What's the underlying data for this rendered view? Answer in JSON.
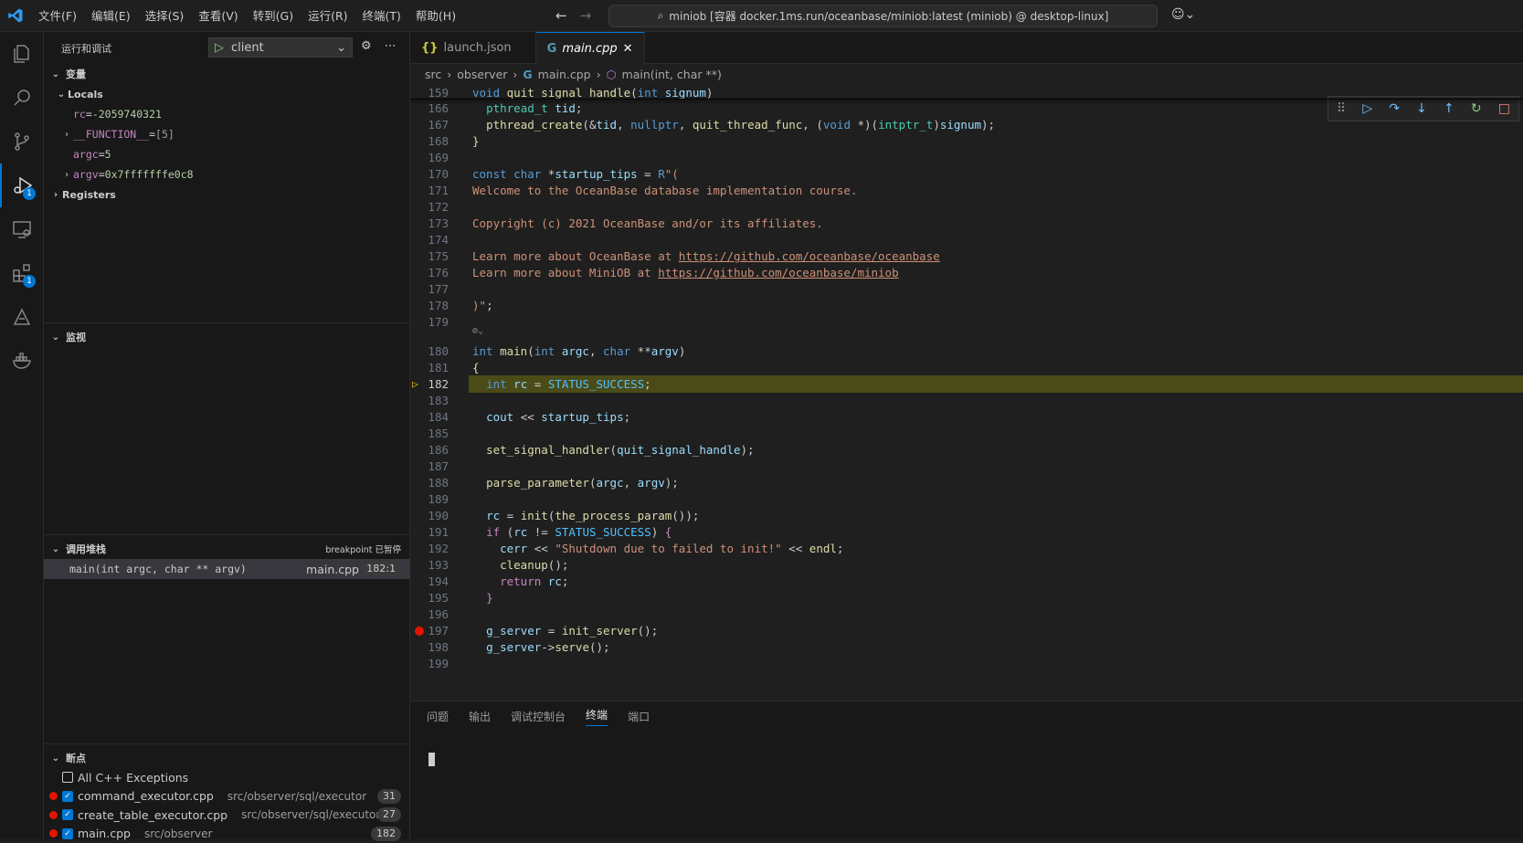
{
  "window": {
    "menus": [
      "文件(F)",
      "编辑(E)",
      "选择(S)",
      "查看(V)",
      "转到(G)",
      "运行(R)",
      "终端(T)",
      "帮助(H)"
    ],
    "command_center": "miniob [容器 docker.1ms.run/oceanbase/miniob:latest (miniob) @ desktop-linux]"
  },
  "activity": {
    "debug_badge": "1",
    "extensions_badge": "1"
  },
  "sidebar": {
    "title": "运行和调试",
    "launch_config": "client",
    "variables": {
      "header": "变量",
      "locals_label": "Locals",
      "items": [
        {
          "name": "rc",
          "value": "-2059740321",
          "expandable": false
        },
        {
          "name": "__FUNCTION__",
          "value": "[5]",
          "expandable": true
        },
        {
          "name": "argc",
          "value": "5",
          "expandable": false
        },
        {
          "name": "argv",
          "value": "0x7fffffffe0c8",
          "expandable": true
        }
      ],
      "registers_label": "Registers"
    },
    "watch": {
      "header": "监视"
    },
    "callstack": {
      "header": "调用堆栈",
      "status": "breakpoint 已暂停",
      "frame_fn": "main(int argc, char ** argv)",
      "frame_file": "main.cpp",
      "frame_pos": "182:1"
    },
    "breakpoints": {
      "header": "断点",
      "items": [
        {
          "label": "All C++ Exceptions",
          "path": "",
          "count": "",
          "checked": false,
          "dot": false
        },
        {
          "label": "command_executor.cpp",
          "path": "src/observer/sql/executor",
          "count": "31",
          "checked": true,
          "dot": true
        },
        {
          "label": "create_table_executor.cpp",
          "path": "src/observer/sql/executor",
          "count": "27",
          "checked": true,
          "dot": true
        },
        {
          "label": "main.cpp",
          "path": "src/observer",
          "count": "182",
          "checked": true,
          "dot": true
        }
      ]
    }
  },
  "editor": {
    "tabs": [
      {
        "label": "launch.json",
        "icon": "{}",
        "active": false
      },
      {
        "label": "main.cpp",
        "icon": "G",
        "active": true
      }
    ],
    "breadcrumb": [
      "src",
      "observer",
      "main.cpp",
      "main(int, char **)"
    ],
    "lines": [
      {
        "n": "159",
        "html": "<span class='kw'>void</span> <span class='fn'>quit_signal_handle</span>(<span class='kw'>int</span> <span class='va'>signum</span>)"
      },
      {
        "n": "166",
        "html": "  <span class='ty'>pthread_t</span> <span class='va'>tid</span>;"
      },
      {
        "n": "167",
        "html": "  <span class='fn'>pthread_create</span>(&amp;<span class='va'>tid</span>, <span class='kw'>nullptr</span>, <span class='fn'>quit_thread_func</span>, (<span class='kw'>void</span> *)(<span class='ty'>intptr_t</span>)<span class='va'>signum</span>);"
      },
      {
        "n": "168",
        "html": "<span class='fn'>}</span>"
      },
      {
        "n": "169",
        "html": ""
      },
      {
        "n": "170",
        "html": "<span class='kw'>const</span> <span class='kw'>char</span> *<span class='va'>startup_tips</span> = <span class='kw'>R</span><span class='st'>\"(</span>"
      },
      {
        "n": "171",
        "html": "<span class='st'>Welcome to the OceanBase database implementation course.</span>"
      },
      {
        "n": "172",
        "html": ""
      },
      {
        "n": "173",
        "html": "<span class='st'>Copyright (c) 2021 OceanBase and/or its affiliates.</span>"
      },
      {
        "n": "174",
        "html": ""
      },
      {
        "n": "175",
        "html": "<span class='st'>Learn more about OceanBase at </span><span class='url'>https://github.com/oceanbase/oceanbase</span>"
      },
      {
        "n": "176",
        "html": "<span class='st'>Learn more about MiniOB at </span><span class='url'>https://github.com/oceanbase/miniob</span>"
      },
      {
        "n": "177",
        "html": ""
      },
      {
        "n": "178",
        "html": "<span class='st'>)\"</span>;"
      },
      {
        "n": "179",
        "html": ""
      },
      {
        "n": "180",
        "html": "<span class='kw'>int</span> <span class='fn'>main</span>(<span class='kw'>int</span> <span class='va'>argc</span>, <span class='kw'>char</span> **<span class='va'>argv</span>)"
      },
      {
        "n": "181",
        "html": "<span class='fn'>{</span>"
      },
      {
        "n": "182",
        "html": "  <span class='kw'>int</span> <span class='va'>rc</span> = <span class='co'>STATUS_SUCCESS</span>;"
      },
      {
        "n": "183",
        "html": ""
      },
      {
        "n": "184",
        "html": "  <span class='va'>cout</span> &lt;&lt; <span class='va'>startup_tips</span>;"
      },
      {
        "n": "185",
        "html": ""
      },
      {
        "n": "186",
        "html": "  <span class='fn'>set_signal_handler</span>(<span class='va'>quit_signal_handle</span>);"
      },
      {
        "n": "187",
        "html": ""
      },
      {
        "n": "188",
        "html": "  <span class='fn'>parse_parameter</span>(<span class='va'>argc</span>, <span class='va'>argv</span>);"
      },
      {
        "n": "189",
        "html": ""
      },
      {
        "n": "190",
        "html": "  <span class='va'>rc</span> = <span class='fn'>init</span>(<span class='fn'>the_process_param</span>());"
      },
      {
        "n": "191",
        "html": "  <span class='pk'>if</span> (<span class='va'>rc</span> != <span class='co'>STATUS_SUCCESS</span>) <span class='pk'>{</span>"
      },
      {
        "n": "192",
        "html": "    <span class='va'>cerr</span> &lt;&lt; <span class='st'>\"Shutdown due to failed to init!\"</span> &lt;&lt; <span class='fn'>endl</span>;"
      },
      {
        "n": "193",
        "html": "    <span class='fn'>cleanup</span>();"
      },
      {
        "n": "194",
        "html": "    <span class='pk'>return</span> <span class='va'>rc</span>;"
      },
      {
        "n": "195",
        "html": "  <span class='pk'>}</span>"
      },
      {
        "n": "196",
        "html": ""
      },
      {
        "n": "197",
        "html": "  <span class='va'>g_server</span> = <span class='fn'>init_server</span>();"
      },
      {
        "n": "198",
        "html": "  <span class='va'>g_server</span>-&gt;<span class='fn'>serve</span>();"
      },
      {
        "n": "199",
        "html": ""
      }
    ],
    "current_line": "182",
    "breakpoint_lines": [
      "197"
    ]
  },
  "panel": {
    "tabs": [
      "问题",
      "输出",
      "调试控制台",
      "终端",
      "端口"
    ],
    "active_tab": "终端"
  }
}
